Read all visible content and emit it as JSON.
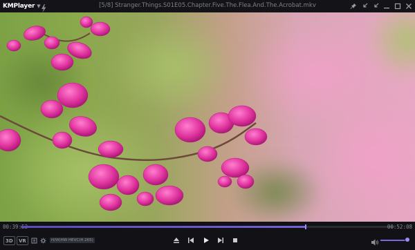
{
  "app": {
    "name": "KMPlayer",
    "title": "[5/8] Stranger.Things.S01E05.Chapter.Five.The.Flea.And.The.Acrobat.mkv"
  },
  "window_buttons": [
    {
      "name": "pin-icon"
    },
    {
      "name": "shrink-icon"
    },
    {
      "name": "expand-icon"
    },
    {
      "name": "minimize-icon"
    },
    {
      "name": "maximize-icon"
    },
    {
      "name": "close-icon"
    }
  ],
  "playback": {
    "current_time": "00:39:53",
    "total_time": "00:52:08",
    "progress_fraction": 0.7636,
    "volume_fraction": 0.88
  },
  "controls": {
    "btn_3d": "3D",
    "btn_vr": "VR",
    "tag_hw": "H/W(HW)",
    "tag_codec": "HEVC(H.265)"
  },
  "colors": {
    "accent": "#7560d4",
    "background": "#121216"
  }
}
